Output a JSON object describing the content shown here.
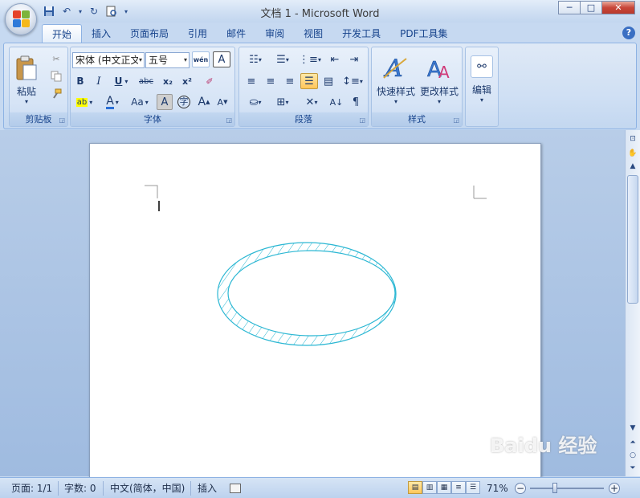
{
  "window": {
    "title": "文档 1 - Microsoft Word",
    "min_label": "─",
    "max_label": "□",
    "close_label": "✕"
  },
  "tabs": [
    {
      "label": "开始"
    },
    {
      "label": "插入"
    },
    {
      "label": "页面布局"
    },
    {
      "label": "引用"
    },
    {
      "label": "邮件"
    },
    {
      "label": "审阅"
    },
    {
      "label": "视图"
    },
    {
      "label": "开发工具"
    },
    {
      "label": "PDF工具集"
    }
  ],
  "ribbon": {
    "clipboard": {
      "group_label": "剪贴板",
      "paste_label": "粘贴"
    },
    "font": {
      "group_label": "字体",
      "font_name": "宋体 (中文正文",
      "font_size": "五号",
      "bold": "B",
      "italic": "I",
      "underline": "U",
      "strike": "abc",
      "subscript": "x₂",
      "superscript": "x²",
      "grow": "A",
      "shrink": "A",
      "case": "Aa",
      "phonetic": "wén",
      "clear": "A",
      "char_border": "A",
      "enclose": "字"
    },
    "paragraph": {
      "group_label": "段落"
    },
    "styles": {
      "group_label": "样式",
      "quick_styles": "快速样式",
      "change_styles": "更改样式"
    },
    "editing": {
      "edit_label": "编辑"
    }
  },
  "document": {
    "shape": "hatched-ellipse",
    "shape_color": "#2bb7d3"
  },
  "statusbar": {
    "page": "页面: 1/1",
    "words": "字数: 0",
    "language": "中文(简体，中国)",
    "mode": "插入",
    "zoom": "71%"
  },
  "watermark": "Baidu 经验",
  "colors": {
    "ribbon_bg": "#d0e0f4",
    "accent": "#15428b",
    "highlight": "#ffc65a"
  }
}
